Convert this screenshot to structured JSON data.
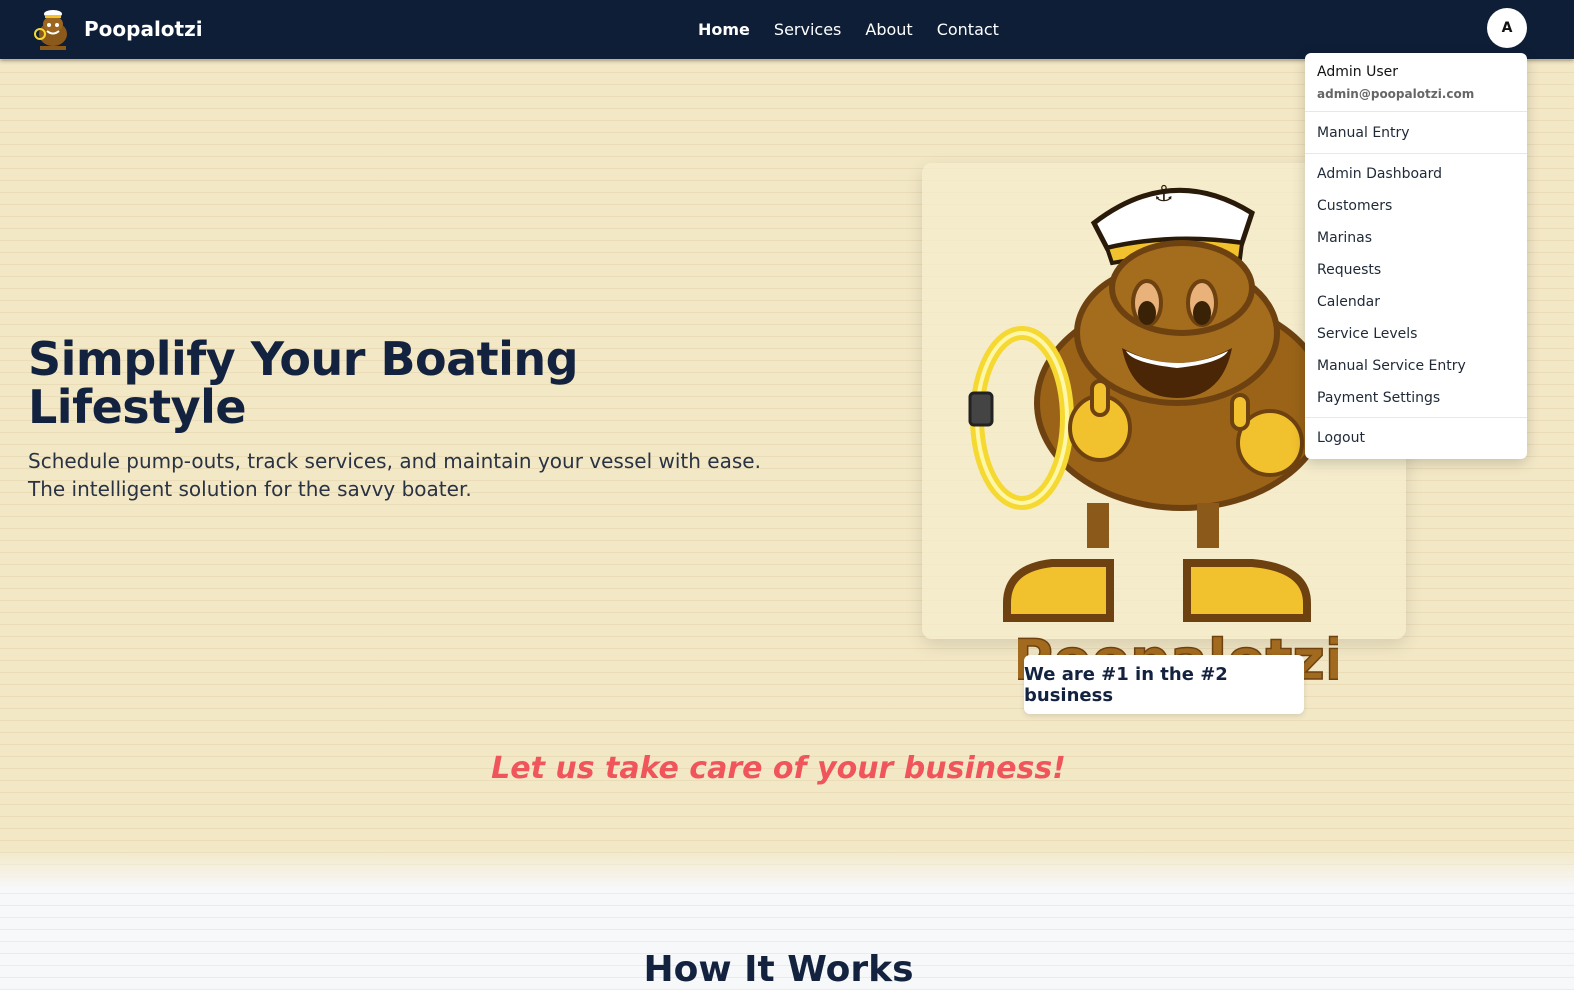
{
  "navbar": {
    "brand": "Poopalotzi",
    "logo_icon": "poop-mascot-logo-icon",
    "links": [
      {
        "label": "Home",
        "active": true
      },
      {
        "label": "Services",
        "active": false
      },
      {
        "label": "About",
        "active": false
      },
      {
        "label": "Contact",
        "active": false
      }
    ],
    "avatar_initial": "A",
    "bg_color": "#0f1e37"
  },
  "hero": {
    "title": "Simplify Your Boating Lifestyle",
    "subtitle": "Schedule pump-outs, track services, and maintain your vessel with ease. The intelligent solution for the savvy boater.",
    "mascot_wordmark": "Poopalotzi",
    "tagline": "We are #1 in the #2 business",
    "cta": "Let us take care of your business!",
    "cta_color": "#f0555b"
  },
  "how_it_works": {
    "title": "How It Works"
  },
  "user_menu": {
    "name": "Admin User",
    "email": "admin@poopalotzi.com",
    "items": [
      {
        "label": "Manual Entry"
      },
      {
        "label": "Admin Dashboard"
      },
      {
        "label": "Customers"
      },
      {
        "label": "Marinas"
      },
      {
        "label": "Requests"
      },
      {
        "label": "Calendar"
      },
      {
        "label": "Service Levels"
      },
      {
        "label": "Manual Service Entry"
      },
      {
        "label": "Payment Settings"
      },
      {
        "label": "Logout"
      }
    ]
  }
}
